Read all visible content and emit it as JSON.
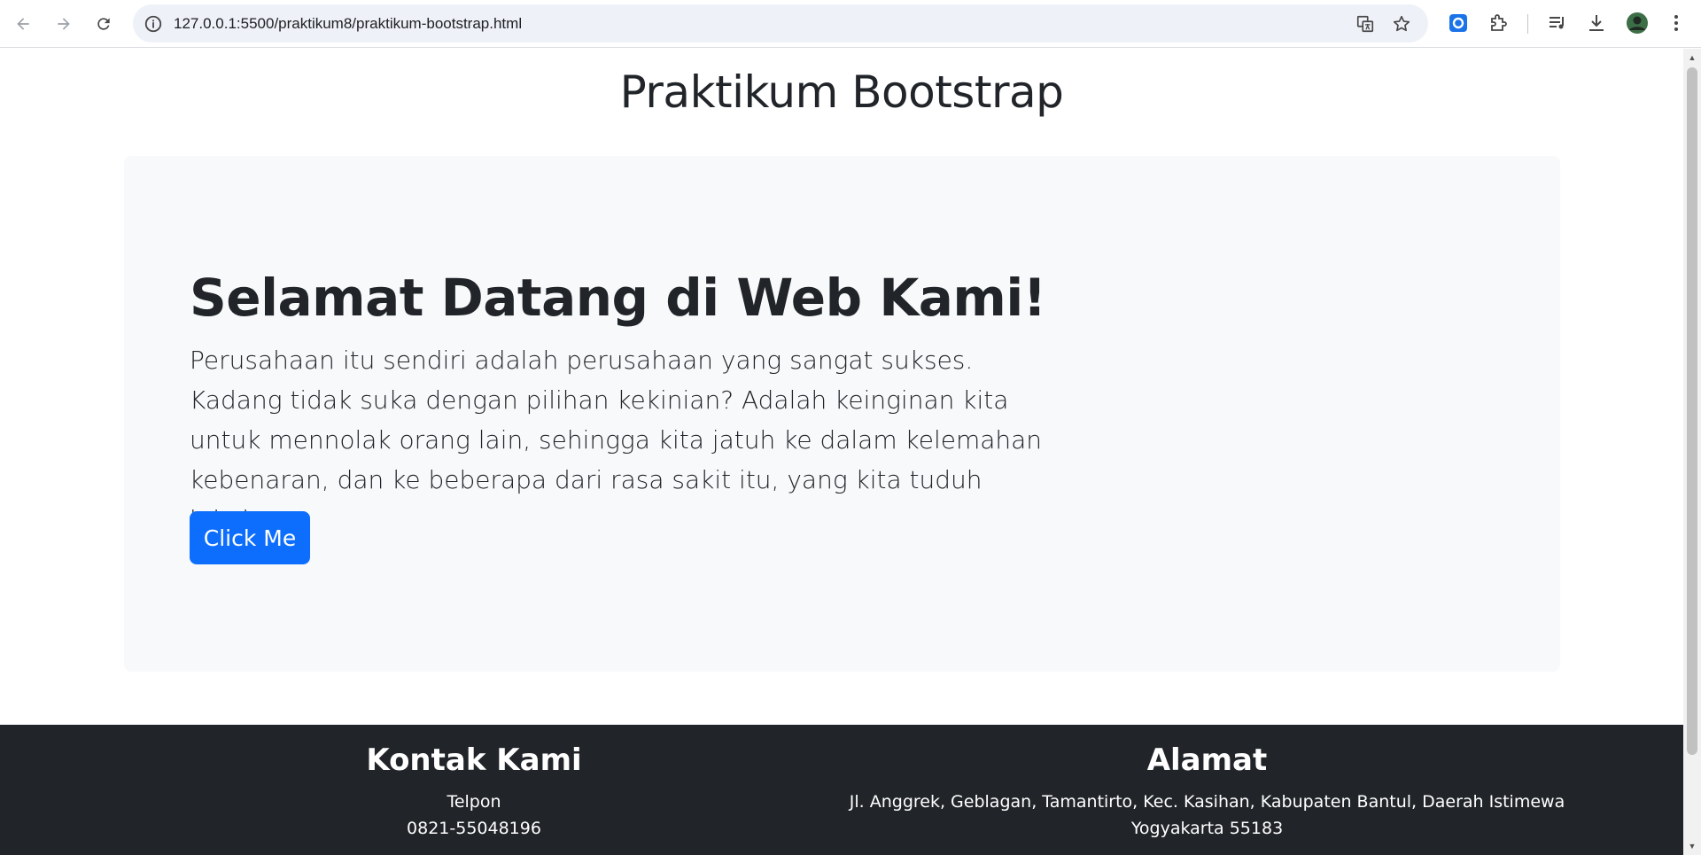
{
  "browser": {
    "url": "127.0.0.1:5500/praktikum8/praktikum-bootstrap.html"
  },
  "page": {
    "title": "Praktikum Bootstrap",
    "hero": {
      "heading": "Selamat Datang di Web Kami!",
      "text": "Perusahaan itu sendiri adalah perusahaan yang sangat sukses. Kadang tidak suka dengan pilihan kekinian? Adalah keinginan kita untuk mennolak orang lain, sehingga kita jatuh ke dalam kelemahan kebenaran, dan ke beberapa dari rasa sakit itu, yang kita tuduh lakukan.",
      "button_label": "Click Me"
    },
    "footer": {
      "contact": {
        "heading": "Kontak Kami",
        "label": "Telpon",
        "phone": "0821-55048196"
      },
      "address": {
        "heading": "Alamat",
        "text": "Jl. Anggrek, Geblagan, Tamantirto, Kec. Kasihan, Kabupaten Bantul, Daerah Istimewa Yogyakarta 55183"
      }
    }
  },
  "colors": {
    "primary": "#0d6efd",
    "dark": "#212529",
    "light": "#f8f9fa"
  }
}
